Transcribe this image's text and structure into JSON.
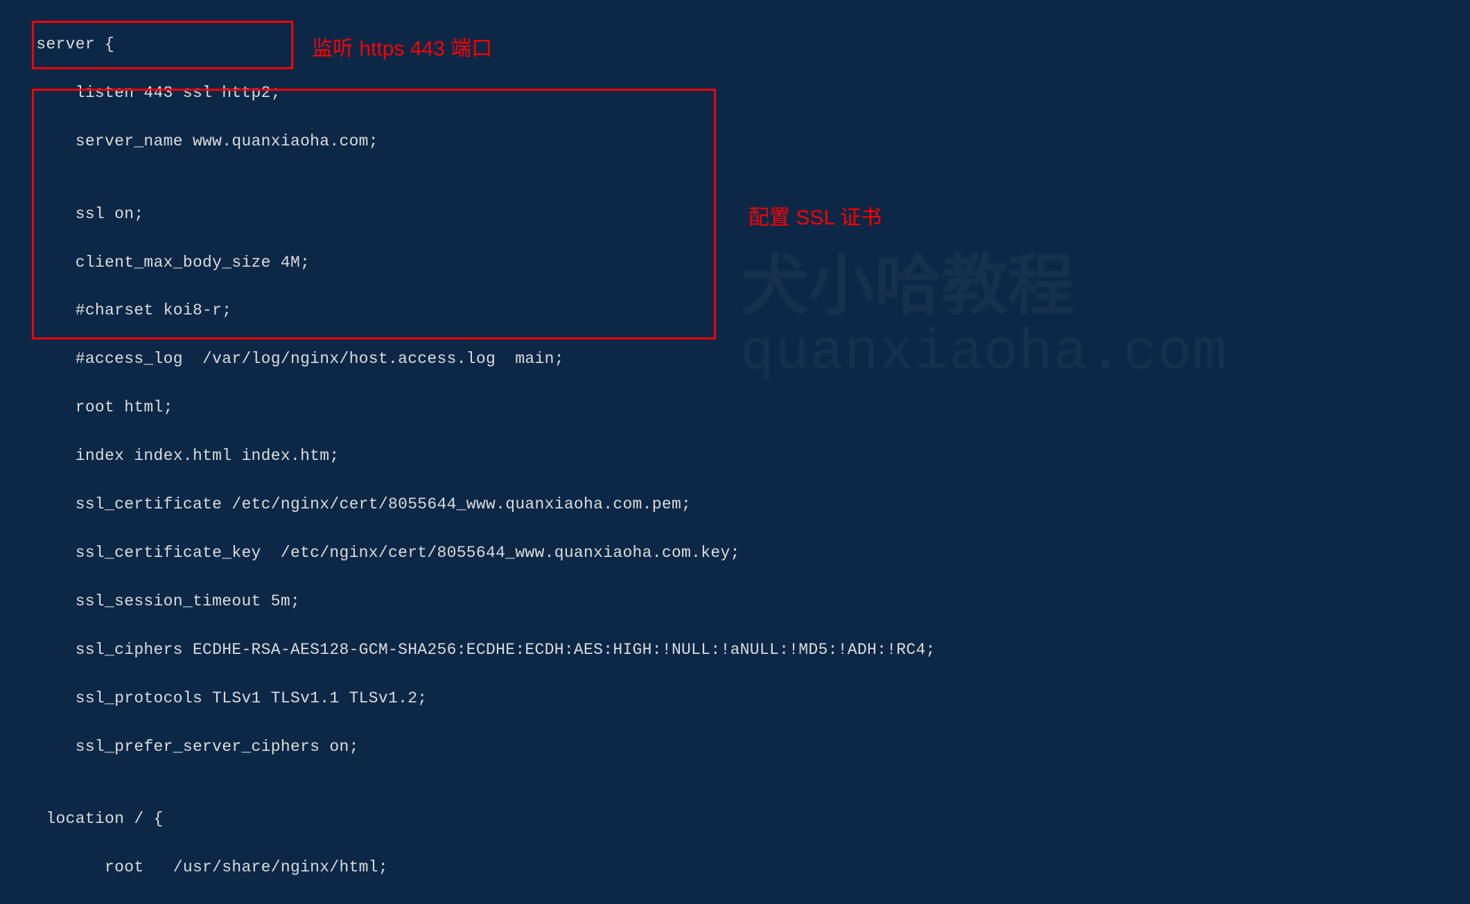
{
  "code": {
    "line01": "   server {",
    "line02": "       listen 443 ssl http2;",
    "line03": "       server_name www.quanxiaoha.com;",
    "line04": "",
    "line05": "       ssl on;",
    "line06": "       client_max_body_size 4M;",
    "line07": "       #charset koi8-r;",
    "line08": "       #access_log  /var/log/nginx/host.access.log  main;",
    "line09": "       root html;",
    "line10": "       index index.html index.htm;",
    "line11": "       ssl_certificate /etc/nginx/cert/8055644_www.quanxiaoha.com.pem;",
    "line12": "       ssl_certificate_key  /etc/nginx/cert/8055644_www.quanxiaoha.com.key;",
    "line13": "       ssl_session_timeout 5m;",
    "line14": "       ssl_ciphers ECDHE-RSA-AES128-GCM-SHA256:ECDHE:ECDH:AES:HIGH:!NULL:!aNULL:!MD5:!ADH:!RC4;",
    "line15": "       ssl_protocols TLSv1 TLSv1.1 TLSv1.2;",
    "line16": "       ssl_prefer_server_ciphers on;",
    "line17": "",
    "line18": "    location / {",
    "line19": "          root   /usr/share/nginx/html;"
  },
  "annotations": {
    "listen_port": "监听 https 443 端口",
    "ssl_config": "配置 SSL 证书"
  },
  "watermark": {
    "brand": "犬小哈教程",
    "url": "quanxiaoha.com"
  }
}
